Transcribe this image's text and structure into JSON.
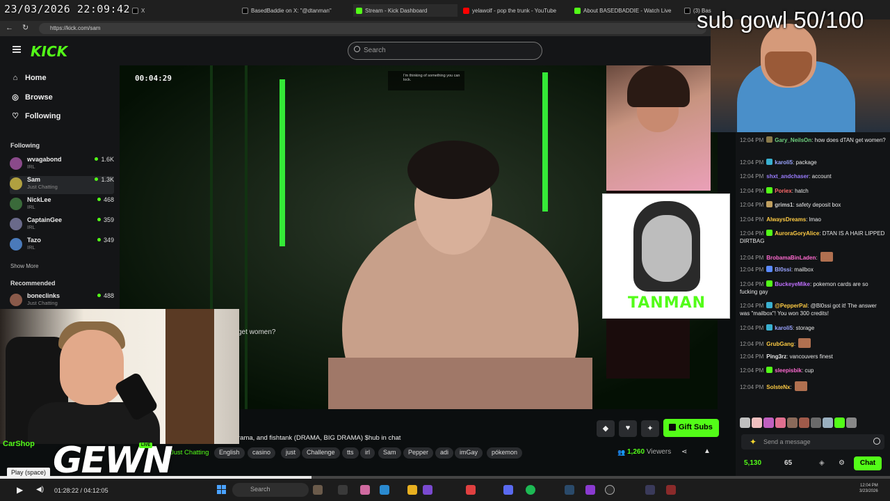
{
  "overlay": {
    "timestamp": "23/03/2026 22:09:42",
    "sub_goal": "sub gowl 50/100",
    "gewn": "GEWN",
    "chat_mini": "CarShop",
    "live": "LIVE",
    "tanman": "TANMAN"
  },
  "browser": {
    "tabs": [
      {
        "label": "X",
        "color": "#000000"
      },
      {
        "label": "BasedBaddie on X: \"@dtanman\"",
        "color": "#000000"
      },
      {
        "label": "Stream - Kick Dashboard",
        "color": "#53fc18"
      },
      {
        "label": "yelawolf - pop the trunk - YouTube",
        "color": "#ff0000"
      },
      {
        "label": "About BASEDBADDIE - Watch Live",
        "color": "#53fc18"
      },
      {
        "label": "(3) Bas",
        "color": "#000000"
      }
    ],
    "url": "https://kick.com/sam"
  },
  "kick": {
    "logo": "KICK",
    "search_placeholder": "Search",
    "nav": [
      {
        "label": "Home",
        "icon": "home-icon"
      },
      {
        "label": "Browse",
        "icon": "compass-icon"
      },
      {
        "label": "Following",
        "icon": "heart-icon"
      }
    ],
    "following_title": "Following",
    "following": [
      {
        "name": "wvagabond",
        "category": "IRL",
        "viewers": "1.6K",
        "color": "#8a4a8a"
      },
      {
        "name": "Sam",
        "category": "Just Chatting",
        "viewers": "1.3K",
        "color": "#b0a040"
      },
      {
        "name": "NickLee",
        "category": "IRL",
        "viewers": "468",
        "color": "#3a6a3a"
      },
      {
        "name": "CaptainGee",
        "category": "IRL",
        "viewers": "359",
        "color": "#6a6a8a"
      },
      {
        "name": "Tazo",
        "category": "IRL",
        "viewers": "349",
        "color": "#4a7aba"
      }
    ],
    "show_more": "Show More",
    "recommended_title": "Recommended",
    "recommended": [
      {
        "name": "boneclinks",
        "category": "Just Chatting",
        "viewers": "488",
        "color": "#8a5a4a"
      }
    ],
    "stream_timer": "00:04:29",
    "donation_text": "I'm thinking of something you can lock.",
    "overlay_caption": "get women?",
    "stream_title": "rama, and fishtank (DRAMA, BIG DRAMA) $hub in chat",
    "category": "Just Chatting",
    "tags": [
      "English",
      "casino",
      "just",
      "Challenge",
      "tts",
      "irl",
      "Sam",
      "Pepper",
      "adi",
      "imGay",
      "pókemon"
    ],
    "viewers_count": "1,260",
    "viewers_label": "Viewers",
    "gift_label": "Gift Subs"
  },
  "chat": {
    "messages": [
      {
        "time": "12:04 PM",
        "user": "Gary_NeilsOn",
        "color": "#6fd07f",
        "badge": "#8a7a4a",
        "text": ": how does dTAN get women?"
      },
      {
        "time": "12:04 PM",
        "user": "karoli5",
        "color": "#9aa4ff",
        "badge": "#3ab0d0",
        "text": ": package"
      },
      {
        "time": "12:04 PM",
        "user": "shxt_andchaser",
        "color": "#9a7cff",
        "badge": "",
        "text": ": account"
      },
      {
        "time": "12:04 PM",
        "user": "Poriex",
        "color": "#ff6a6a",
        "badge": "#53fc18",
        "text": ": hatch"
      },
      {
        "time": "12:04 PM",
        "user": "grims1",
        "color": "#d0d0d0",
        "badge": "#c0a060",
        "text": ": safety deposit box"
      },
      {
        "time": "12:04 PM",
        "user": "AlwaysDreams",
        "color": "#ffcc44",
        "badge": "",
        "text": ": lmao"
      },
      {
        "time": "12:04 PM",
        "user": "AuroraGoryAlice",
        "color": "#ffcc44",
        "badge": "#53fc18",
        "text": ": DTAN IS A HAIR LIPPED DIRTBAG"
      },
      {
        "time": "12:04 PM",
        "user": "BrobamaBinLaden",
        "color": "#ff6ad0",
        "badge": "",
        "text": ":"
      },
      {
        "time": "12:04 PM",
        "user": "Bl0ssi",
        "color": "#9aa4ff",
        "badge": "#5a8aff",
        "text": ": mailbox"
      },
      {
        "time": "12:04 PM",
        "user": "BuckeyeMike",
        "color": "#c070ff",
        "badge": "#53fc18",
        "text": ": pokemon cards are so fucking gay"
      },
      {
        "time": "12:04 PM",
        "user": "@PepperPal",
        "color": "#ffcc44",
        "badge": "#3ab0d0",
        "text": ": @Bl0ssi got it! The answer was \"mailbox\"! You won 300 credits!"
      },
      {
        "time": "12:04 PM",
        "user": "karoli5",
        "color": "#9aa4ff",
        "badge": "#3ab0d0",
        "text": ": storage"
      },
      {
        "time": "12:04 PM",
        "user": "GrubGang",
        "color": "#ffcc44",
        "badge": "",
        "text": ":"
      },
      {
        "time": "12:04 PM",
        "user": "Ping3rz",
        "color": "#e8e8e8",
        "badge": "",
        "text": ": vancouvers finest"
      },
      {
        "time": "12:04 PM",
        "user": "sleepisbik",
        "color": "#ff6ad0",
        "badge": "#53fc18",
        "text": ": cup"
      },
      {
        "time": "12:04 PM",
        "user": "SolsteNx",
        "color": "#ffcc44",
        "badge": "",
        "text": ":"
      }
    ],
    "input_placeholder": "Send a message",
    "points": "5,130",
    "points2": "65",
    "chat_button": "Chat"
  },
  "player": {
    "tooltip": "Play (space)",
    "time": "01:28:22 / 04:12:05",
    "progress": 0.35
  },
  "taskbar": {
    "search": "Search",
    "clock_time": "12:04 PM",
    "clock_date": "3/23/2026"
  }
}
